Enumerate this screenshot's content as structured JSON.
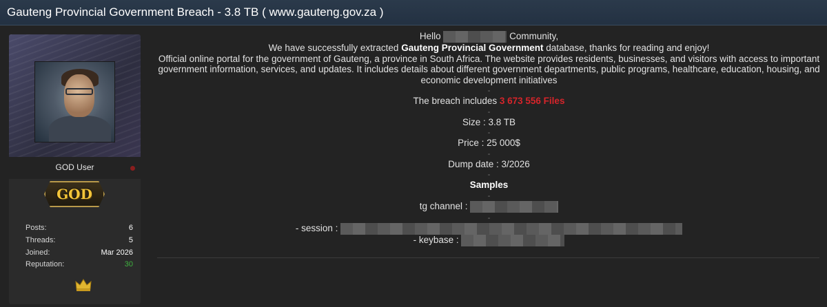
{
  "thread": {
    "title": "Gauteng Provincial Government Breach - 3.8 TB ( www.gauteng.gov.za )"
  },
  "user": {
    "username": "GOD User",
    "rank": "GOD",
    "stats": [
      {
        "label": "Posts:",
        "value": "6"
      },
      {
        "label": "Threads:",
        "value": "5"
      },
      {
        "label": "Joined:",
        "value": "Mar 2026"
      },
      {
        "label": "Reputation:",
        "value": "30"
      }
    ],
    "icons": {
      "avatar": "avatar-image",
      "badge": "god-rank-badge",
      "crown": "crown-icon"
    },
    "colors": {
      "reputation": "#3fb13f",
      "status": "#8a1e1e"
    }
  },
  "post": {
    "greeting_prefix": "Hello",
    "greeting_suffix": "Community,",
    "line2_prefix": "We have successfully extracted",
    "line2_bold": "Gauteng Provincial Government",
    "line2_suffix": "database, thanks for reading and enjoy!",
    "description": "Official online portal for the government of Gauteng, a province in South Africa. The website provides residents, businesses, and visitors with access to important government information, services, and updates. It includes details about different government departments, public programs, healthcare, education, housing, and economic development initiatives",
    "separator": "-",
    "breach_prefix": "The breach includes",
    "breach_files": "3 673 556 Files",
    "size": "Size : 3.8 TB",
    "price": "Price : 25 000$",
    "dump_date": "Dump date : 3/2026",
    "samples": "Samples",
    "tg_label": "tg channel :",
    "session_label": "- session :",
    "keybase_label": "- keybase :",
    "colors": {
      "highlight": "#d6242a"
    }
  }
}
